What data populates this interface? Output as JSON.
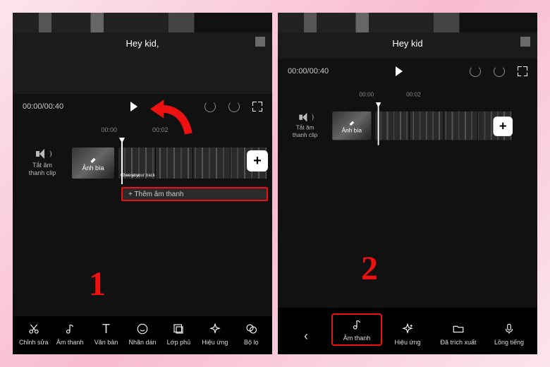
{
  "panel1": {
    "subtitle": "Hey kid,",
    "time": "00:00/00:40",
    "ruler": {
      "t0": "00:00",
      "t1": "00:02"
    },
    "mute_label_l1": "Tắt âm",
    "mute_label_l2": "thanh clip",
    "cover_label": "Ảnh bìa",
    "track_labels": [
      "Choose your track",
      "Chae your",
      "Choose your track",
      "Chae your"
    ],
    "add_sound": "+ Thêm âm thanh",
    "step": "1",
    "tools": [
      {
        "label": "Chỉnh sửa",
        "icon": "scissors"
      },
      {
        "label": "Âm thanh",
        "icon": "note"
      },
      {
        "label": "Văn bản",
        "icon": "text"
      },
      {
        "label": "Nhãn dán",
        "icon": "sticker"
      },
      {
        "label": "Lớp phủ",
        "icon": "overlay"
      },
      {
        "label": "Hiệu ứng",
        "icon": "sparkle"
      },
      {
        "label": "Bộ lọ",
        "icon": "dots"
      }
    ]
  },
  "panel2": {
    "subtitle": "Hey kid",
    "time": "00:00/00:40",
    "ruler": {
      "t0": "00:00",
      "t1": "00:02"
    },
    "mute_label_l1": "Tắt âm",
    "mute_label_l2": "thanh clip",
    "cover_label": "Ảnh bìa",
    "step": "2",
    "tools": [
      {
        "label": "",
        "icon": "back"
      },
      {
        "label": "Âm thanh",
        "icon": "note",
        "hl": true
      },
      {
        "label": "Hiệu ứng",
        "icon": "sparkle"
      },
      {
        "label": "Đã trích xuất",
        "icon": "folder"
      },
      {
        "label": "Lồng tiếng",
        "icon": "mic"
      }
    ]
  }
}
